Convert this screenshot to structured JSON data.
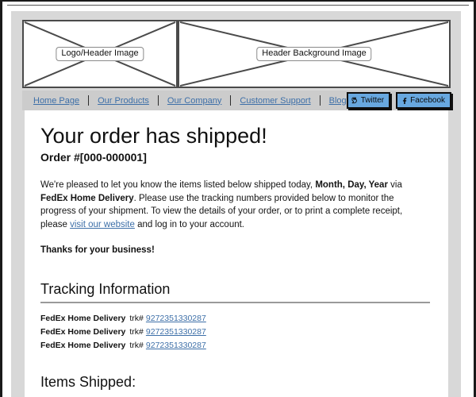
{
  "header": {
    "logo_image_label": "Logo/Header Image",
    "background_image_label": "Header Background Image"
  },
  "nav": {
    "links": [
      {
        "label": "Home Page"
      },
      {
        "label": "Our Products"
      },
      {
        "label": "Our Company"
      },
      {
        "label": "Customer Support"
      },
      {
        "label": "Blog"
      }
    ],
    "social": [
      {
        "label": "Twitter",
        "icon": "twitter-bird-icon",
        "glyph": "✉"
      },
      {
        "label": "Facebook",
        "icon": "facebook-f-icon",
        "glyph": "f"
      }
    ]
  },
  "email": {
    "headline": "Your order has shipped!",
    "order_number": "Order #[000-000001]",
    "body": {
      "part1": "We're pleased to let you know the items listed below shipped today, ",
      "date_placeholder": "Month, Day, Year",
      "part2": " via ",
      "carrier": "FedEx Home Delivery",
      "part3": ". Please use the tracking numbers provided below to monitor the progress of your shipment. To view the details of your order, or to print a complete receipt, please ",
      "link_text": "visit our website",
      "part4": " and log in to your account."
    },
    "thanks": "Thanks for your business!",
    "tracking_heading": "Tracking Information",
    "tracking_rows": [
      {
        "carrier": "FedEx Home Delivery",
        "label": "trk#",
        "number": "9272351330287"
      },
      {
        "carrier": "FedEx Home Delivery",
        "label": "trk#",
        "number": "9272351330287"
      },
      {
        "carrier": "FedEx Home Delivery",
        "label": "trk#",
        "number": "9272351330287"
      }
    ],
    "items_shipped_heading": "Items Shipped:"
  },
  "colors": {
    "link_blue": "#3d6fa8",
    "social_button_blue": "#68a8e0",
    "page_gray": "#d8d8d8",
    "nav_gray": "#cccccc",
    "rule_gray": "#9a9a9a"
  }
}
